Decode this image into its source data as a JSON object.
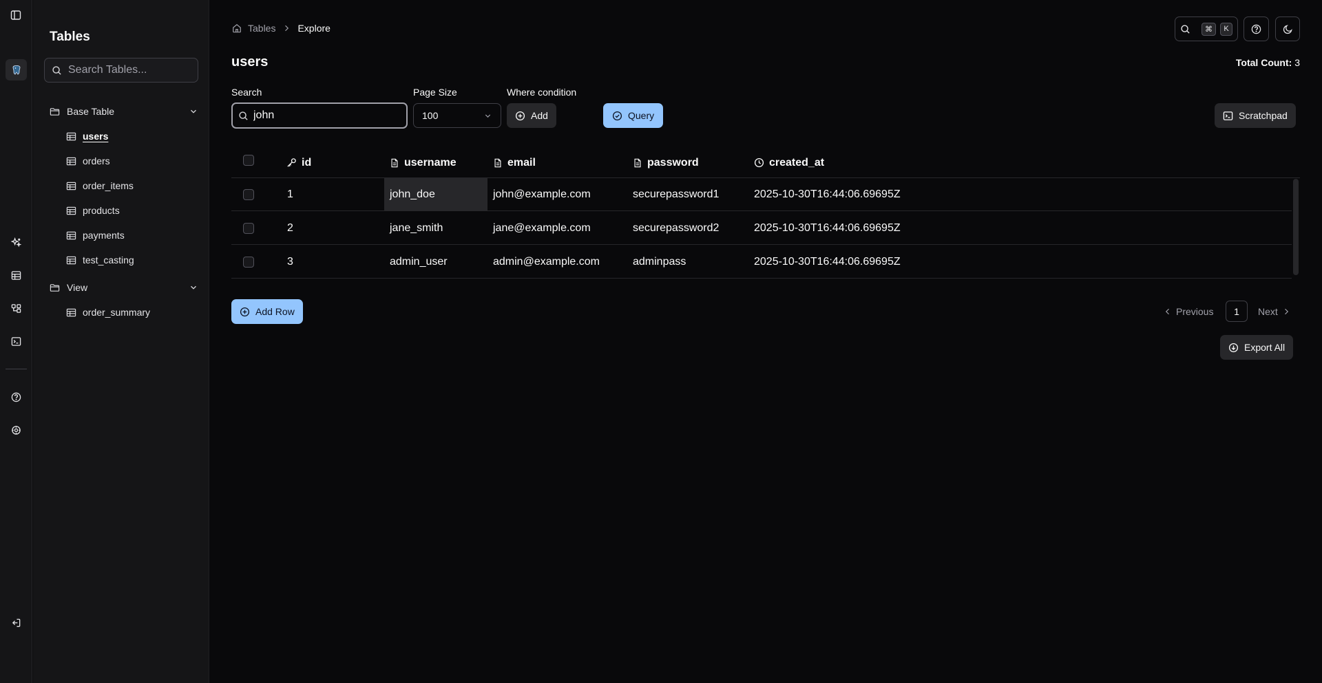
{
  "rail": {
    "icons": [
      "panel-toggle-icon",
      "database-icon",
      "ai-sparkle-icon",
      "table-icon",
      "schema-icon",
      "terminal-icon",
      "help-icon",
      "settings-icon",
      "logout-icon"
    ]
  },
  "sidebar": {
    "title": "Tables",
    "search_placeholder": "Search Tables...",
    "groups": [
      {
        "label": "Base Table",
        "items": [
          {
            "label": "users",
            "active": true
          },
          {
            "label": "orders"
          },
          {
            "label": "order_items"
          },
          {
            "label": "products"
          },
          {
            "label": "payments"
          },
          {
            "label": "test_casting"
          }
        ]
      },
      {
        "label": "View",
        "items": [
          {
            "label": "order_summary"
          }
        ]
      }
    ]
  },
  "breadcrumb": {
    "root": "Tables",
    "current": "Explore"
  },
  "topbar": {
    "kbd_cmd": "⌘",
    "kbd_k": "K"
  },
  "page": {
    "title": "users",
    "total_label": "Total Count:",
    "total_value": "3"
  },
  "filters": {
    "search_label": "Search",
    "search_value": "john",
    "page_size_label": "Page Size",
    "page_size_value": "100",
    "where_label": "Where condition",
    "add_label": "Add",
    "query_label": "Query",
    "scratchpad_label": "Scratchpad"
  },
  "table": {
    "columns": [
      {
        "label": "id",
        "icon": "key-icon"
      },
      {
        "label": "username",
        "icon": "text-file-icon"
      },
      {
        "label": "email",
        "icon": "text-file-icon"
      },
      {
        "label": "password",
        "icon": "text-file-icon"
      },
      {
        "label": "created_at",
        "icon": "clock-icon"
      }
    ],
    "rows": [
      [
        "1",
        "john_doe",
        "john@example.com",
        "securepassword1",
        "2025-10-30T16:44:06.69695Z"
      ],
      [
        "2",
        "jane_smith",
        "jane@example.com",
        "securepassword2",
        "2025-10-30T16:44:06.69695Z"
      ],
      [
        "3",
        "admin_user",
        "admin@example.com",
        "adminpass",
        "2025-10-30T16:44:06.69695Z"
      ]
    ]
  },
  "footer": {
    "add_row_label": "Add Row",
    "previous_label": "Previous",
    "current_page": "1",
    "next_label": "Next",
    "export_label": "Export All"
  },
  "colors": {
    "background": "#09090b",
    "sidebar": "#151517",
    "accent": "#93c5fd",
    "border": "#27272a"
  }
}
